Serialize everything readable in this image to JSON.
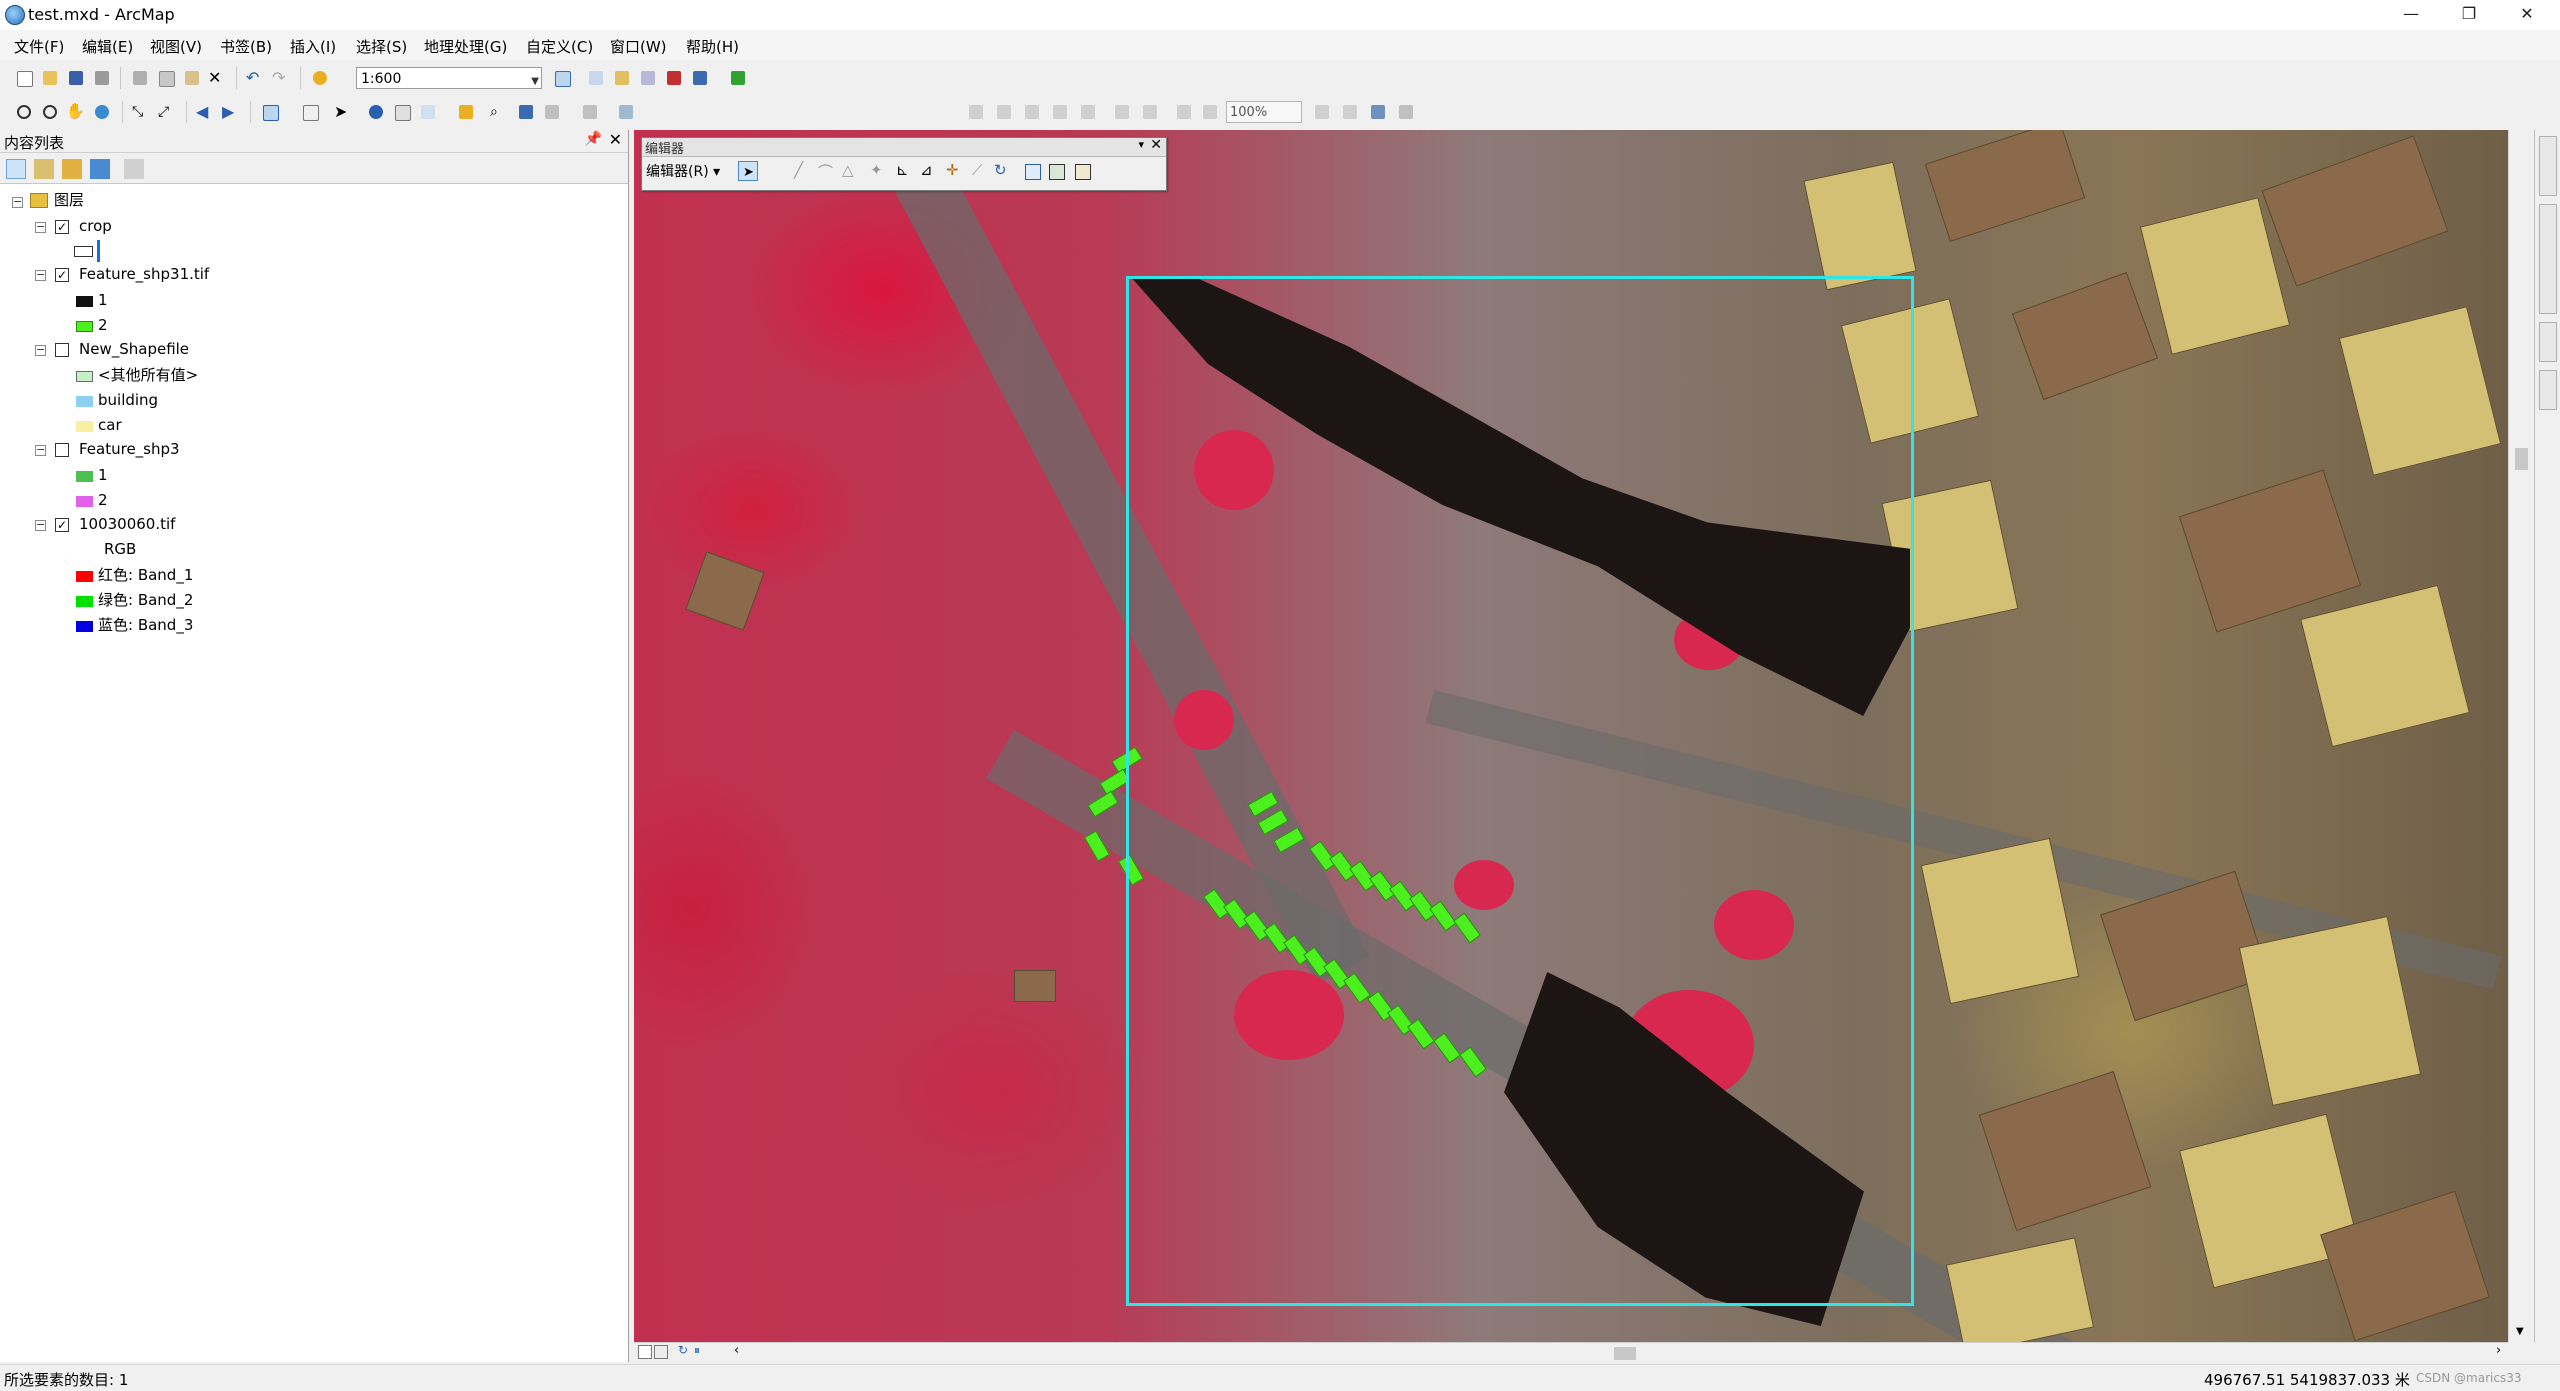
{
  "window": {
    "title": "test.mxd - ArcMap"
  },
  "menu": [
    "文件(F)",
    "编辑(E)",
    "视图(V)",
    "书签(B)",
    "插入(I)",
    "选择(S)",
    "地理处理(G)",
    "自定义(C)",
    "窗口(W)",
    "帮助(H)"
  ],
  "toolbar": {
    "scale": "1:600",
    "zoom": "100%"
  },
  "toc": {
    "title": "内容列表",
    "root": "图层",
    "layers": [
      {
        "name": "crop",
        "checked": true
      },
      {
        "name": "Feature_shp31.tif",
        "checked": true,
        "classes": [
          "1",
          "2"
        ]
      },
      {
        "name": "New_Shapefile",
        "checked": false,
        "classes": [
          "<其他所有值>",
          "building",
          "car"
        ]
      },
      {
        "name": "Feature_shp3",
        "checked": false,
        "classes": [
          "1",
          "2"
        ]
      },
      {
        "name": "10030060.tif",
        "checked": true,
        "rgb_label": "RGB",
        "bands": [
          "红色:    Band_1",
          "绿色: Band_2",
          "蓝色:    Band_3"
        ]
      }
    ]
  },
  "editor": {
    "title": "编辑器",
    "menu_label": "编辑器(R) ▾"
  },
  "status": {
    "selection": "所选要素的数目: 1",
    "coords": "496767.51  5419837.033 米",
    "watermark": "CSDN @marics33"
  },
  "colors": {
    "cyan_frame": "#2ee6e6",
    "green_class": "#4cf01e",
    "red_band": "#ff0000",
    "green_band": "#00e000",
    "blue_band": "#0000e0"
  }
}
